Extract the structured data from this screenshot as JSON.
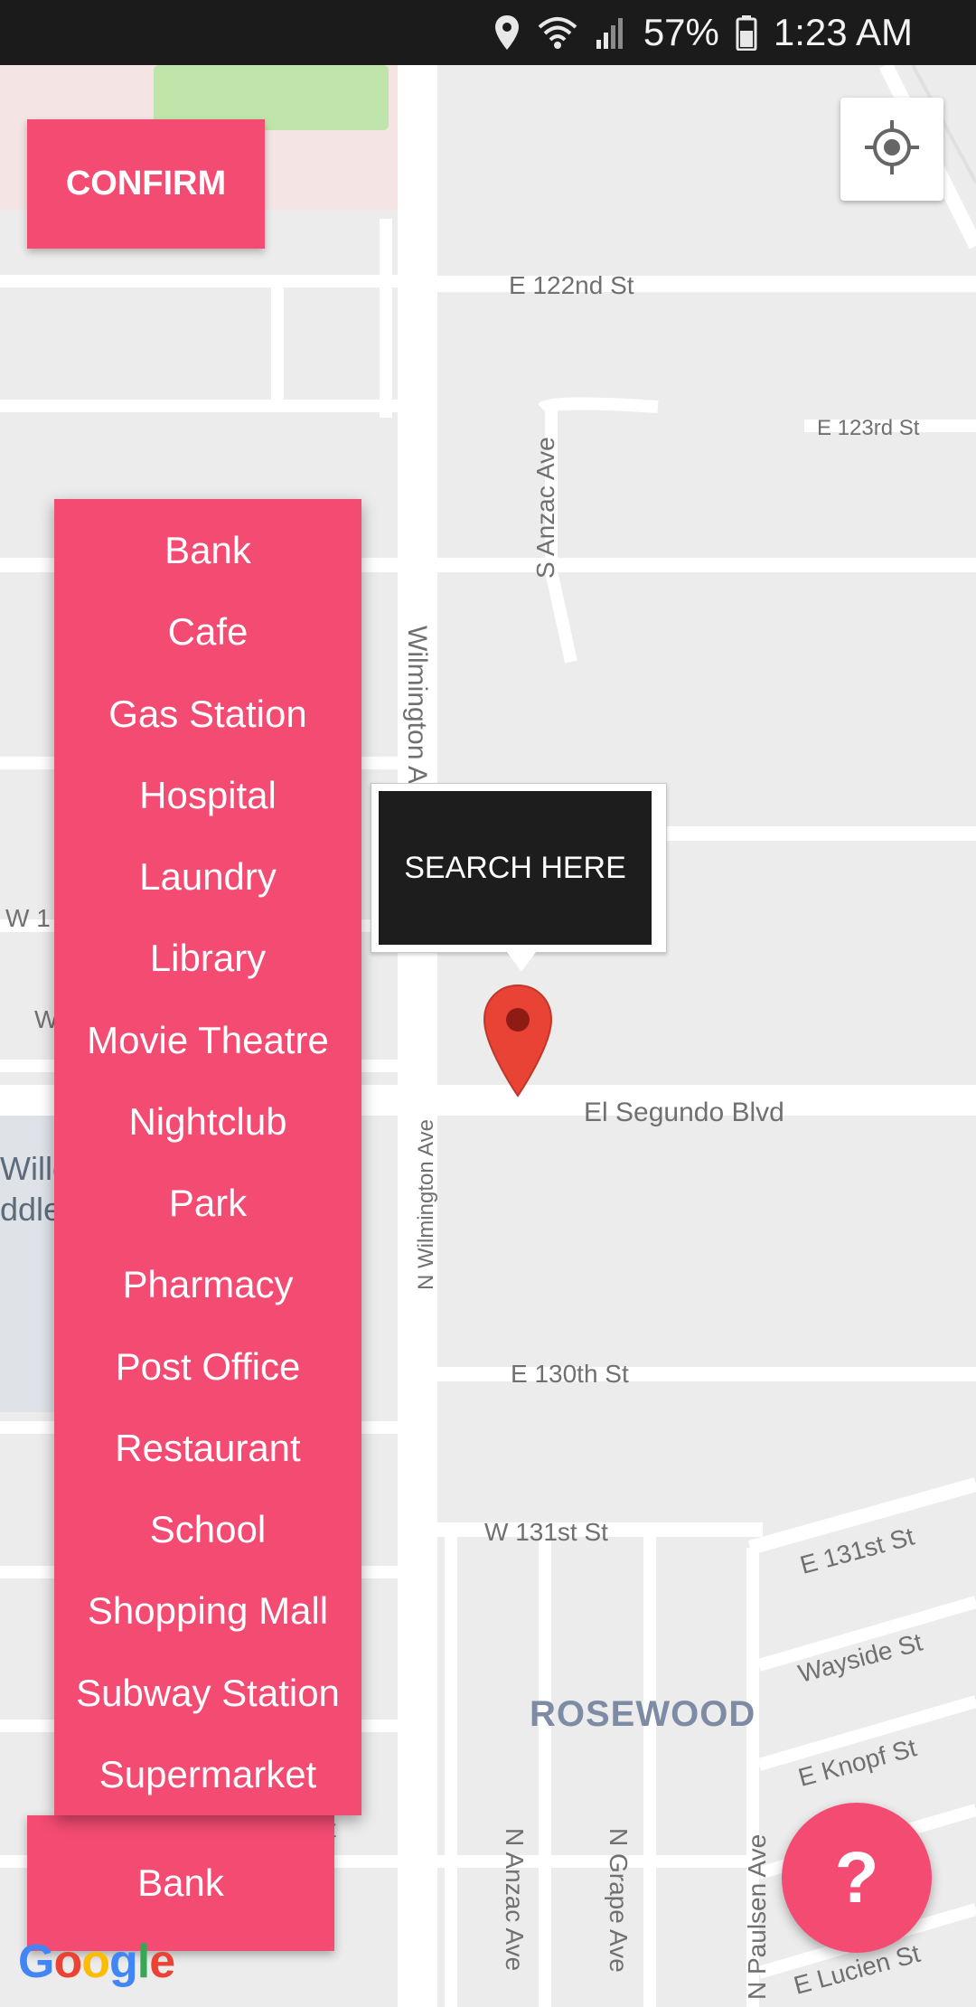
{
  "status_bar": {
    "battery": "57%",
    "time": "1:23 AM",
    "icons": [
      "location-icon",
      "wifi-icon",
      "signal-icon",
      "battery-icon"
    ]
  },
  "confirm_button": {
    "label": "CONFIRM"
  },
  "locate_button": {
    "icon": "my-location-icon"
  },
  "place_list": {
    "items": [
      "Bank",
      "Cafe",
      "Gas Station",
      "Hospital",
      "Laundry",
      "Library",
      "Movie Theatre",
      "Nightclub",
      "Park",
      "Pharmacy",
      "Post Office",
      "Restaurant",
      "School",
      "Shopping Mall",
      "Subway Station",
      "Supermarket"
    ]
  },
  "selected_place": {
    "value": "Bank"
  },
  "info_window": {
    "label": "SEARCH HERE"
  },
  "help_button": {
    "label": "?"
  },
  "map": {
    "attribution": "Google",
    "streets": {
      "e122": "E 122nd St",
      "e123": "E 123rd St",
      "s_anzac": "S Anzac Ave",
      "wilmington": "Wilmington A",
      "n_wilmington": "N Wilmington Ave",
      "el_segundo": "El Segundo Blvd",
      "e130": "E 130th St",
      "w131": "W 131st St",
      "e131": "E 131st St",
      "wayside": "Wayside St",
      "knopf": "E Knopf St",
      "n_anzac": "N Anzac Ave",
      "n_grape": "N Grape Ave",
      "n_paulsen": "N Paulsen Ave",
      "lucien": "E Lucien St",
      "w1": "W 1",
      "w2": "W",
      "st": "st",
      "willo": "Willo",
      "ddle": "ddle"
    },
    "area": "ROSEWOOD"
  },
  "colors": {
    "accent": "#f44b73",
    "marker": "#e84335",
    "status_bar": "#1b1b1b",
    "map_bg": "#ececec"
  }
}
